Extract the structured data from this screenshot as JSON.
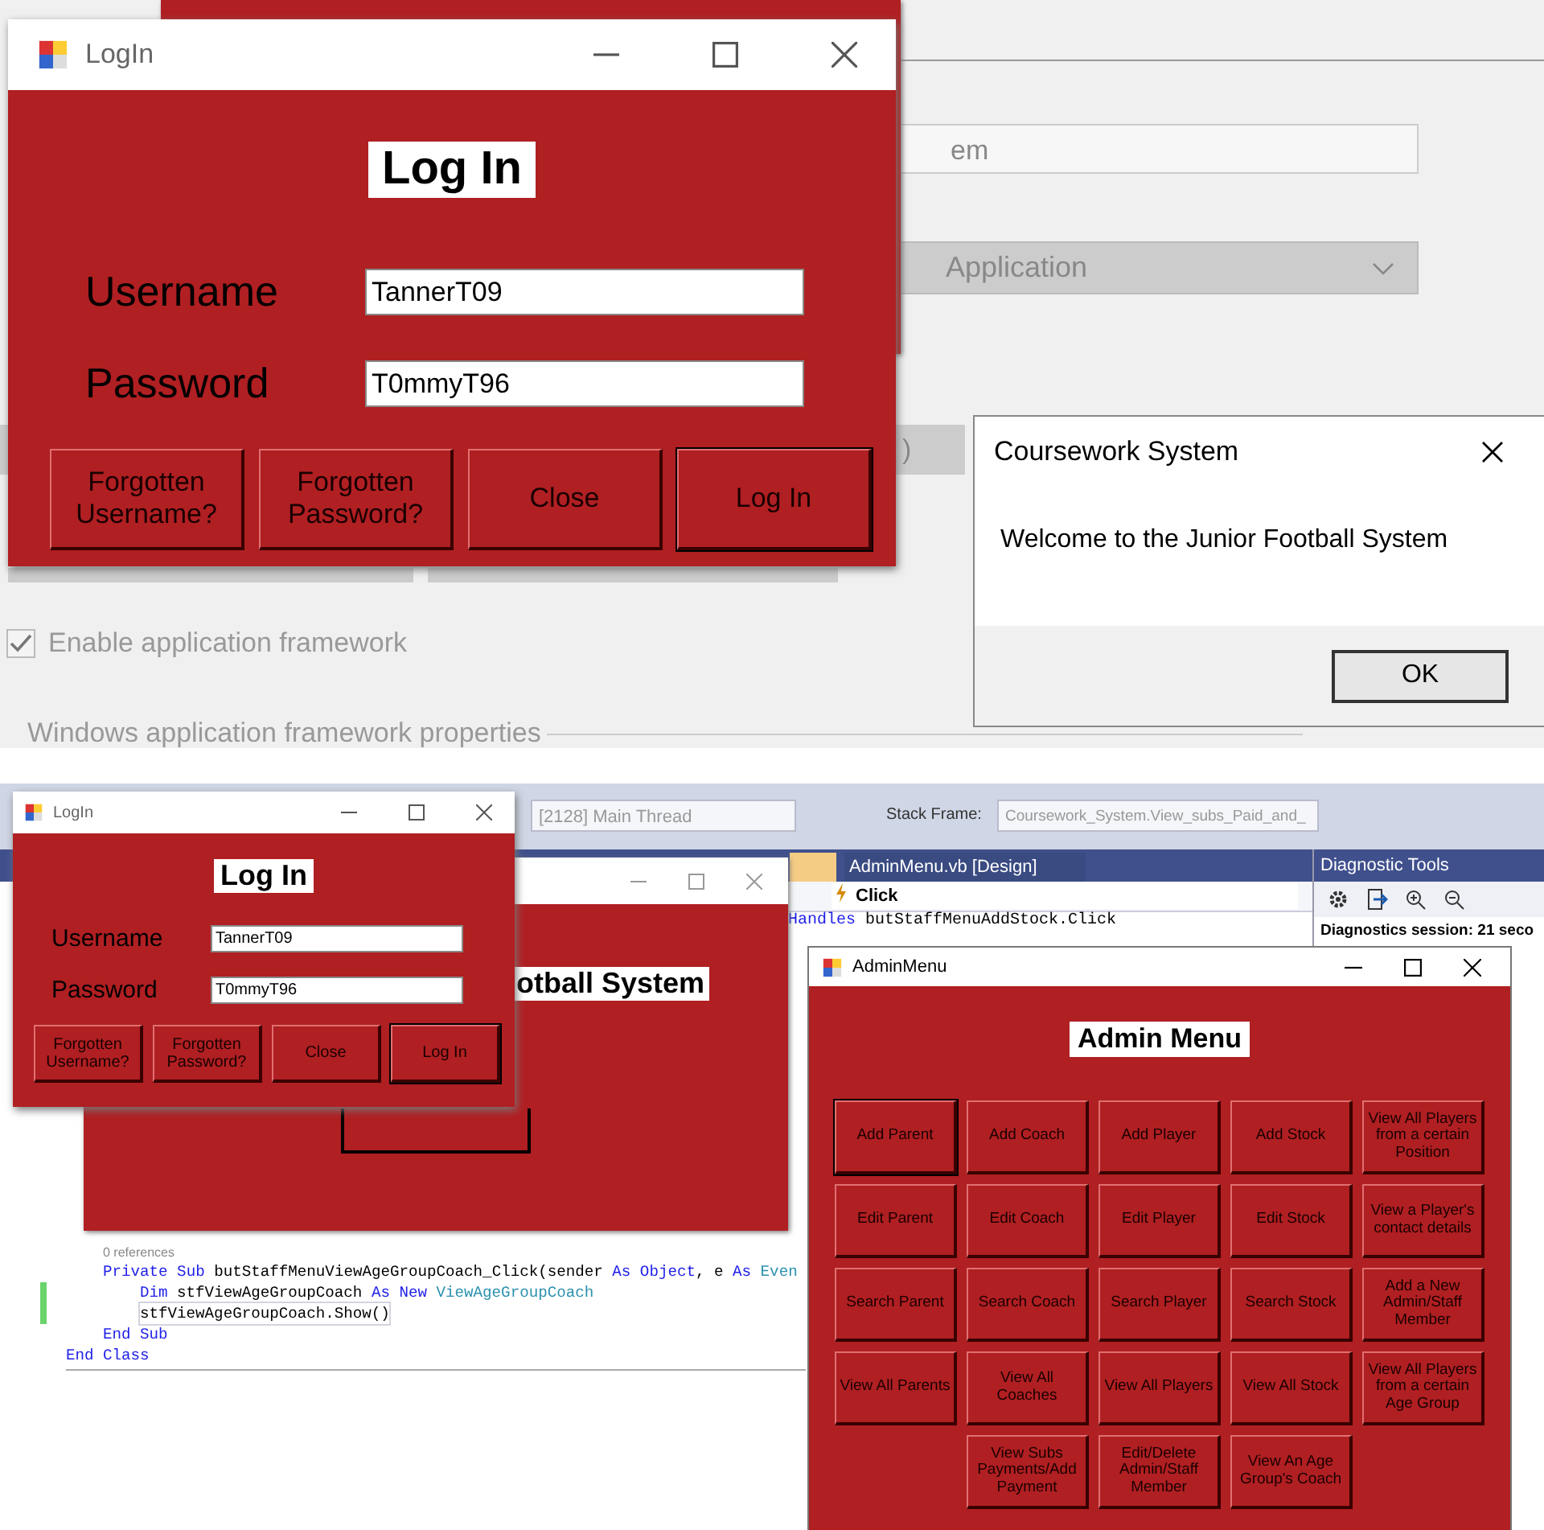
{
  "top_screen": {
    "properties_page": {
      "field_value": "em",
      "dropdown_value": "Application",
      "partial_text": ")",
      "checkbox": {
        "label": "Enable application framework",
        "checked": true
      },
      "group_label": "Windows application framework properties"
    },
    "login_window": {
      "title": "LogIn",
      "heading": "Log In",
      "fields": [
        {
          "label": "Username",
          "value": "TannerT09"
        },
        {
          "label": "Password",
          "value": "T0mmyT96"
        }
      ],
      "buttons": [
        {
          "label": "Forgotten Username?",
          "focused": false
        },
        {
          "label": "Forgotten Password?",
          "focused": false
        },
        {
          "label": "Close",
          "focused": false
        },
        {
          "label": "Log In",
          "focused": true
        }
      ]
    },
    "message_box": {
      "title": "Coursework System",
      "message": "Welcome to the Junior Football System",
      "button": "OK"
    }
  },
  "bottom_screen": {
    "toolbar": {
      "thread": "[2128] Main Thread",
      "stack_frame_label": "Stack Frame:",
      "stack_frame_value": "Coursework_System.View_subs_Paid_and_"
    },
    "editor": {
      "tab": "AdminMenu.vb [Design]",
      "event_dropdown": "Click",
      "top_line": [
        {
          "text": "Handles",
          "kind": "keyword"
        },
        {
          "text": " butStaffMenuAddStock.Click",
          "kind": "plain"
        }
      ],
      "code": [
        {
          "kind": "group",
          "children": [
            {
              "kind": "codelens",
              "text": "0 references"
            },
            {
              "kind": "code",
              "changed": false,
              "current": false,
              "tokens": [
                {
                  "text": "Private Sub",
                  "kind": "keyword"
                },
                {
                  "text": " butStaffMenuViewAgeGroupCoach_Click(sender",
                  "kind": "plain"
                },
                {
                  "text": " As Object",
                  "kind": "keyword"
                },
                {
                  "text": ", e",
                  "kind": "plain"
                },
                {
                  "text": " As",
                  "kind": "keyword"
                },
                {
                  "text": " Even",
                  "kind": "type"
                }
              ],
              "children": [
                {
                  "kind": "code",
                  "changed": true,
                  "current": false,
                  "tokens": [
                    {
                      "text": "Dim",
                      "kind": "keyword"
                    },
                    {
                      "text": " stfViewAgeGroupCoach",
                      "kind": "plain"
                    },
                    {
                      "text": " As New",
                      "kind": "keyword"
                    },
                    {
                      "text": " ViewAgeGroupCoach",
                      "kind": "type"
                    }
                  ]
                },
                {
                  "kind": "code",
                  "changed": true,
                  "current": true,
                  "tokens": [
                    {
                      "text": "stfViewAgeGroupCoach.Show()",
                      "kind": "plain"
                    }
                  ]
                }
              ]
            },
            {
              "kind": "code",
              "changed": false,
              "current": false,
              "tokens": [
                {
                  "text": "End Sub",
                  "kind": "keyword"
                }
              ]
            }
          ]
        },
        {
          "kind": "code",
          "changed": false,
          "current": false,
          "tokens": [
            {
              "text": "End Class",
              "kind": "keyword"
            }
          ]
        }
      ]
    },
    "diagnostic_tools": {
      "title": "Diagnostic Tools",
      "session": "Diagnostics session: 21 seco"
    },
    "background_form": {
      "heading_fragment": "otball System"
    },
    "login_window": {
      "title": "LogIn",
      "heading": "Log In",
      "fields": [
        {
          "label": "Username",
          "value": "TannerT09"
        },
        {
          "label": "Password",
          "value": "T0mmyT96"
        }
      ],
      "buttons": [
        {
          "label": "Forgotten Username?",
          "focused": false
        },
        {
          "label": "Forgotten Password?",
          "focused": false
        },
        {
          "label": "Close",
          "focused": false
        },
        {
          "label": "Log In",
          "focused": true
        }
      ]
    },
    "admin_menu": {
      "title": "AdminMenu",
      "heading": "Admin Menu",
      "button_rows": [
        [
          {
            "label": "Add Parent",
            "focused": true
          },
          {
            "label": "Add Coach",
            "focused": false
          },
          {
            "label": "Add Player",
            "focused": false
          },
          {
            "label": "Add Stock",
            "focused": false
          },
          {
            "label": "View All Players from a certain Position",
            "focused": false
          }
        ],
        [
          {
            "label": "Edit Parent",
            "focused": false
          },
          {
            "label": "Edit Coach",
            "focused": false
          },
          {
            "label": "Edit Player",
            "focused": false
          },
          {
            "label": "Edit Stock",
            "focused": false
          },
          {
            "label": "View a Player's contact details",
            "focused": false
          }
        ],
        [
          {
            "label": "Search Parent",
            "focused": false
          },
          {
            "label": "Search Coach",
            "focused": false
          },
          {
            "label": "Search Player",
            "focused": false
          },
          {
            "label": "Search Stock",
            "focused": false
          },
          {
            "label": "Add a New Admin/Staff Member",
            "focused": false
          }
        ],
        [
          {
            "label": "View All Parents",
            "focused": false
          },
          {
            "label": "View All Coaches",
            "focused": false
          },
          {
            "label": "View All Players",
            "focused": false
          },
          {
            "label": "View All Stock",
            "focused": false
          },
          {
            "label": "View All Players from a certain Age Group",
            "focused": false
          }
        ],
        [
          {
            "label": "View Subs Payments/Add Payment",
            "focused": false
          },
          {
            "label": "Edit/Delete Admin/Staff Member",
            "focused": false
          },
          {
            "label": "View An Age Group's Coach",
            "focused": false
          }
        ]
      ]
    }
  }
}
